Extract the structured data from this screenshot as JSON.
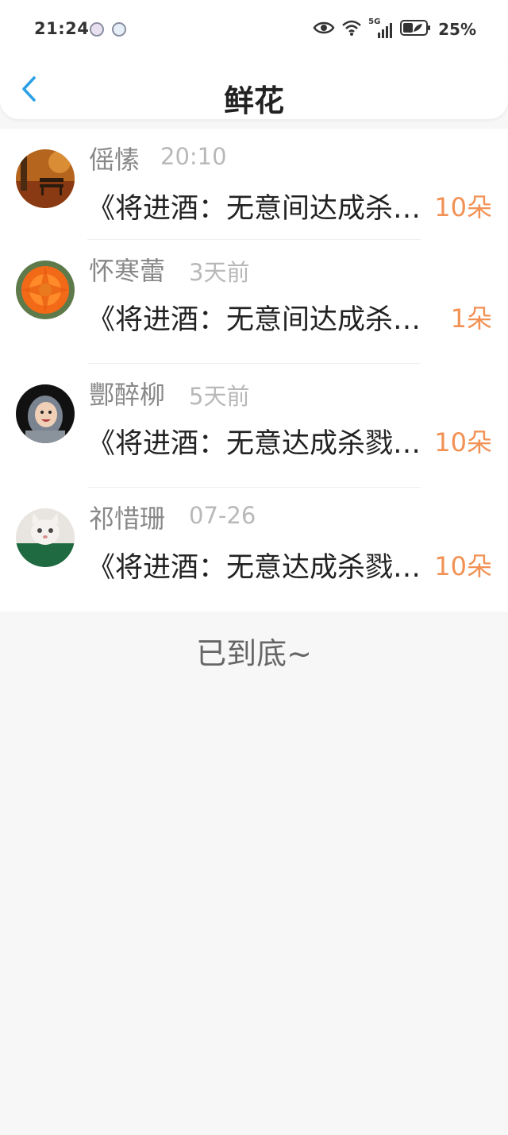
{
  "status_bar": {
    "time": "21:24",
    "notification_icons": [
      "app-notification-icon",
      "app-notification-icon"
    ],
    "right_icons": [
      "eye-icon",
      "wifi-icon",
      "cellular-5g-icon",
      "battery-icon"
    ],
    "network_label": "5G",
    "battery": "25%"
  },
  "header": {
    "back_icon": "chevron-left-icon",
    "title": "鲜花"
  },
  "items": [
    {
      "name": "傜愫",
      "time": "20:10",
      "message": "《将进酒：无意间达成杀戮成就",
      "count": "10朵"
    },
    {
      "name": "怀寒蕾",
      "time": "3天前",
      "message": "《将进酒：无意间达成杀戮成就",
      "count": "1朵"
    },
    {
      "name": "酆醉柳",
      "time": "5天前",
      "message": "《将进酒：无意达成杀戮成就",
      "count": "10朵"
    },
    {
      "name": "祁惜珊",
      "time": "07-26",
      "message": "《将进酒：无意达成杀戮成就",
      "count": "10朵"
    }
  ],
  "footer": {
    "end_text": "已到底~"
  },
  "colors": {
    "accent_back": "#2aa0e6",
    "count": "#f29154",
    "page_bg": "#f8f7f7"
  }
}
